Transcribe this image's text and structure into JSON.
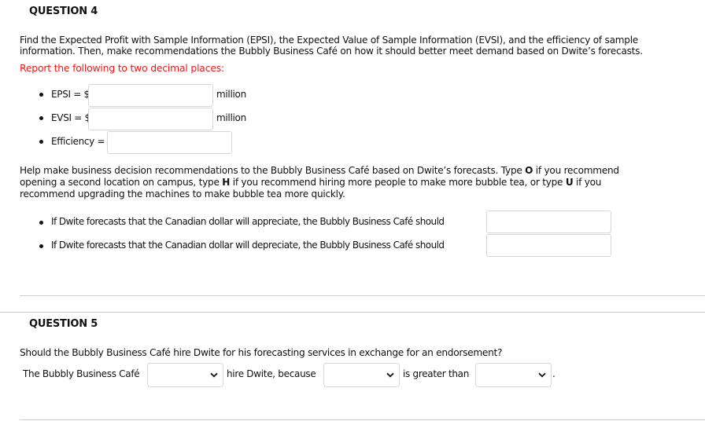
{
  "question4": {
    "title": "QUESTION 4",
    "intro_line1": "Find the Expected Profit with Sample Information (EPSI), the Expected Value of Sample Information (EVSI), and the efficiency of sample",
    "intro_line2": "information. Then, make recommendations the Bubbly Business Café on how it should better meet demand based on Dwite’s forecasts.",
    "instruction": "Report the following to two decimal places:",
    "fields": [
      {
        "label": "EPSI = $",
        "value": "",
        "unit": "million"
      },
      {
        "label": "EVSI = $",
        "value": "",
        "unit": "million"
      },
      {
        "label": "Efficiency =",
        "value": "",
        "unit": ""
      }
    ],
    "help_line1_a": "Help make business decision recommendations to the Bubbly Business Café based on Dwite’s forecasts. Type ",
    "help_line1_bold": "O",
    "help_line1_b": " if you recommend",
    "help_line2_a": "opening a second location on campus, type ",
    "help_line2_bold1": "H",
    "help_line2_b": " if you recommend hiring more people to make more bubble tea, or type ",
    "help_line2_bold2": "U",
    "help_line2_c": " if you",
    "help_line3": "recommend upgrading the machines to make bubble tea more quickly.",
    "recommendations": [
      {
        "label": "If Dwite forecasts that the Canadian dollar will appreciate, the Bubbly Business Café should",
        "value": ""
      },
      {
        "label": "If Dwite forecasts that the Canadian dollar will depreciate, the Bubbly Business Café should",
        "value": ""
      }
    ]
  },
  "question5": {
    "title": "QUESTION 5",
    "prompt": "Should the Bubbly Business Café hire Dwite for his forecasting services in exchange for an endorsement?",
    "sentence_start": "The Bubbly Business Café",
    "sentence_mid": "hire Dwite, because",
    "sentence_mid2": "is greater than",
    "sentence_end": ".",
    "dropdowns": [
      {
        "name": "hire-decision",
        "selected": ""
      },
      {
        "name": "first-value",
        "selected": ""
      },
      {
        "name": "second-value",
        "selected": ""
      }
    ]
  },
  "icons": {
    "dropdown": "chevron-down-icon"
  }
}
